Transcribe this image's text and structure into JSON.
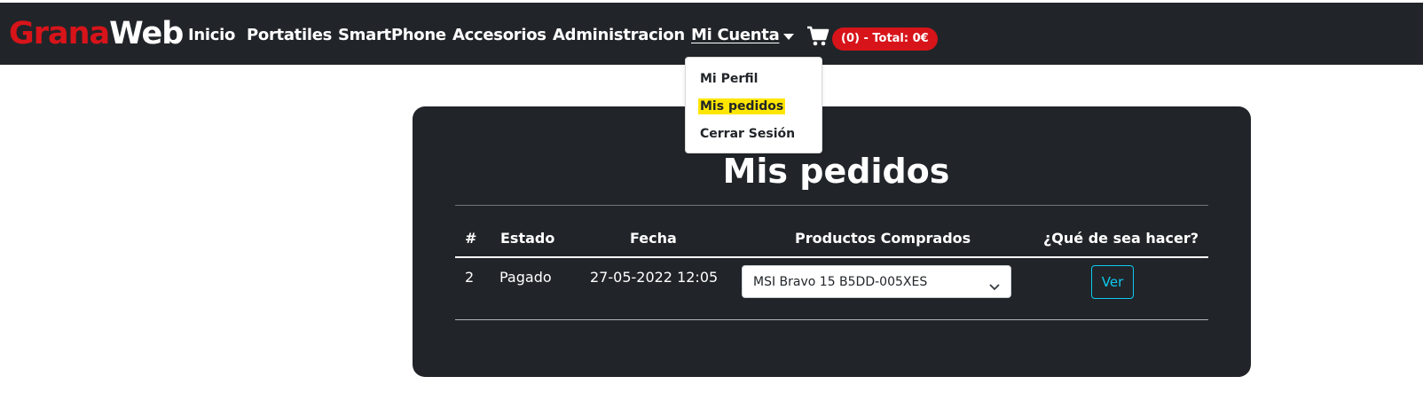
{
  "brand": {
    "part1": "Grana",
    "part2": "Web"
  },
  "nav": {
    "items": [
      {
        "label": "Inicio"
      },
      {
        "label": "Portatiles"
      },
      {
        "label": "SmartPhone"
      },
      {
        "label": "Accesorios"
      },
      {
        "label": "Administracion"
      }
    ],
    "account_label": "Mi Cuenta",
    "cart_badge": "(0) - Total: 0€"
  },
  "dropdown": {
    "items": [
      {
        "label": "Mi Perfil"
      },
      {
        "label": "Mis pedidos"
      },
      {
        "label": "Cerrar Sesión"
      }
    ]
  },
  "orders": {
    "title": "Mis pedidos",
    "columns": [
      "#",
      "Estado",
      "Fecha",
      "Productos Comprados",
      "¿Qué de sea hacer?"
    ],
    "rows": [
      {
        "id": "2",
        "estado": "Pagado",
        "fecha": "27-05-2022 12:05",
        "producto": "MSI Bravo 15 B5DD-005XES",
        "action": "Ver"
      }
    ]
  },
  "colors": {
    "navbar": "#212529",
    "brand_red": "#d7141a",
    "highlight": "#ffe600",
    "info": "#0dcaf0"
  },
  "icons": {
    "cart": "shopping-cart-icon",
    "caret": "caret-down-icon",
    "select_chevron": "chevron-down-icon"
  }
}
